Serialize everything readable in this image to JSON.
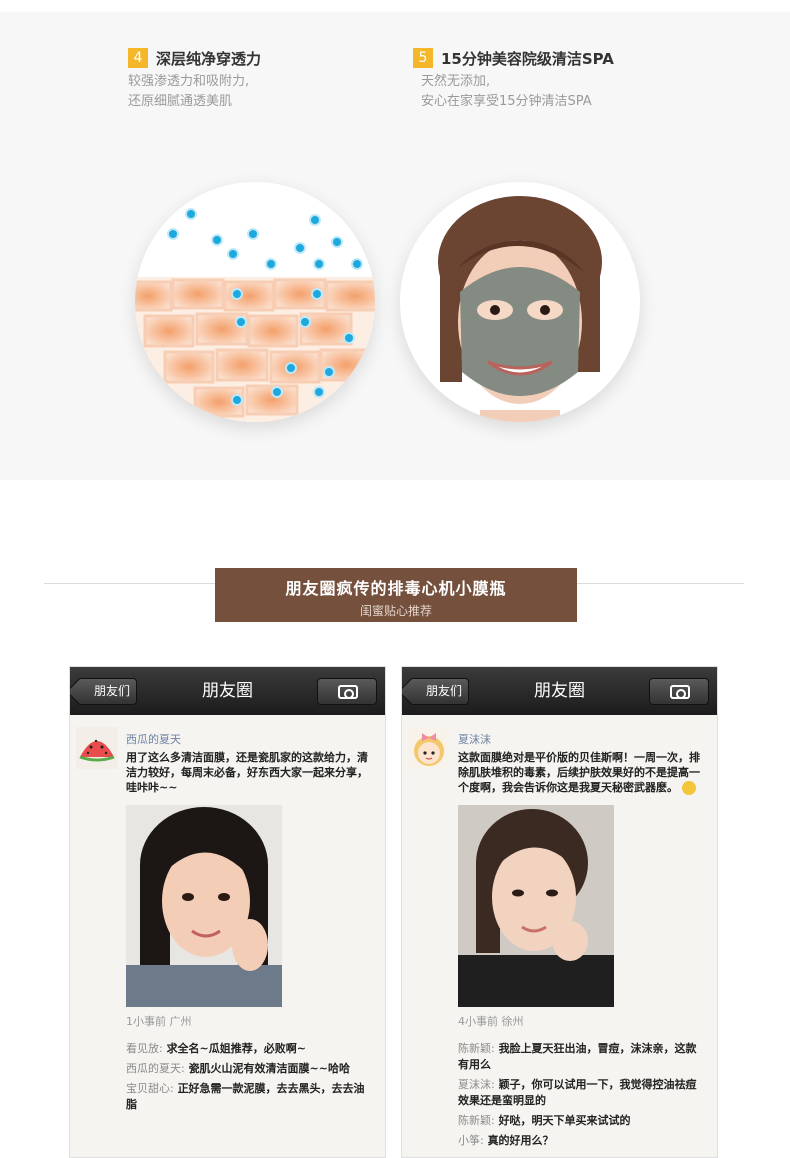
{
  "features": [
    {
      "number": "4",
      "title": "深层纯净穿透力",
      "desc_lines": [
        "较强渗透力和吸附力,",
        "还原细腻通透美肌"
      ]
    },
    {
      "number": "5",
      "title": "15分钟美容院级清洁SPA",
      "desc_lines": [
        "天然无添加,",
        "安心在家享受15分钟清洁SPA"
      ]
    }
  ],
  "banner": {
    "title": "朋友圈疯传的排毒心机小膜瓶",
    "subtitle": "闺蜜贴心推荐"
  },
  "phones": [
    {
      "back_label": "朋友们",
      "title": "朋友圈",
      "poster": "西瓜的夏天",
      "avatar_icon": "watermelon-avatar-icon",
      "post_text": "用了这么多清洁面膜，还是瓷肌家的这款给力，清洁力较好，每周末必备，好东西大家一起来分享，哇咔咔~~",
      "meta": "1小事前 广州",
      "comments": [
        {
          "name": "看见放:",
          "text": "求全名~瓜姐推荐，必败啊~"
        },
        {
          "name": "西瓜的夏天:",
          "text": "瓷肌火山泥有效清洁面膜~~哈哈"
        },
        {
          "name": "宝贝甜心:",
          "text": "正好急需一款泥膜，去去黑头，去去油脂"
        }
      ]
    },
    {
      "back_label": "朋友们",
      "title": "朋友圈",
      "poster": "夏沫沫",
      "avatar_icon": "cartoon-girl-avatar-icon",
      "post_text": "这款面膜绝对是平价版的贝佳斯啊！一周一次，排除肌肤堆积的毒素，后续护肤效果好的不是提高一个度啊，我会告诉你这是我夏天秘密武器麽。",
      "meta": "4小事前 徐州",
      "comments": [
        {
          "name": "陈新颖:",
          "text": "我脸上夏天狂出油，冒痘，沫沫亲，这款有用么"
        },
        {
          "name": "夏沫沫:",
          "text": "颖子，你可以试用一下，我觉得控油祛痘效果还是蛮明显的"
        },
        {
          "name": "陈新颖:",
          "text": "好哒，明天下单买来试试的"
        },
        {
          "name": "小筝:",
          "text": "真的好用么？"
        }
      ]
    }
  ],
  "colors": {
    "badge": "#f5b72a",
    "banner": "#74503d",
    "poster_name": "#6d80a4"
  }
}
